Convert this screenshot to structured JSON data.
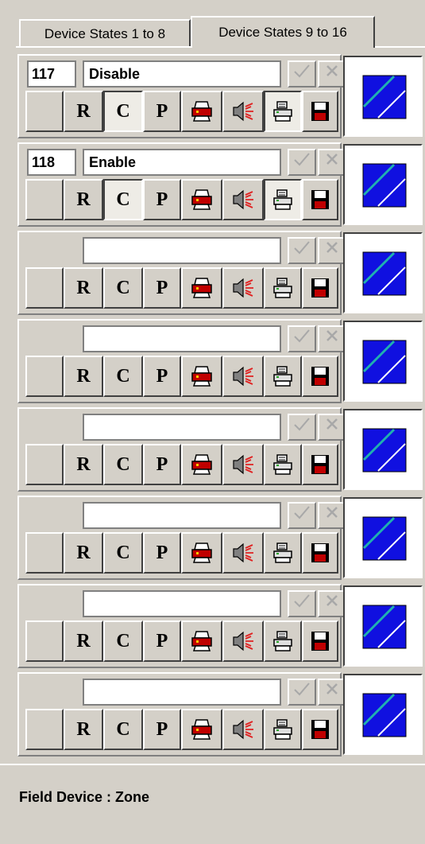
{
  "tabs": [
    {
      "label": "Device States 1 to 8",
      "active": false
    },
    {
      "label": "Device States 9 to 16",
      "active": true
    }
  ],
  "rows": [
    {
      "number": "117",
      "name": "Disable",
      "pressed": [
        "c",
        "doc"
      ]
    },
    {
      "number": "118",
      "name": "Enable",
      "pressed": [
        "c",
        "doc"
      ]
    },
    {
      "number": "",
      "name": "",
      "pressed": []
    },
    {
      "number": "",
      "name": "",
      "pressed": []
    },
    {
      "number": "",
      "name": "",
      "pressed": []
    },
    {
      "number": "",
      "name": "",
      "pressed": []
    },
    {
      "number": "",
      "name": "",
      "pressed": []
    },
    {
      "number": "",
      "name": "",
      "pressed": []
    }
  ],
  "button_labels": {
    "r": "R",
    "c": "C",
    "p": "P"
  },
  "icons": {
    "ok": "checkmark-icon",
    "x": "close-icon",
    "printer": "printer-icon",
    "speaker": "sounder-icon",
    "doc": "print-log-icon",
    "save": "save-icon",
    "state": "device-state-icon"
  },
  "colors": {
    "state_fill": "#1010e0",
    "state_line": "#20b0b0"
  },
  "footer": {
    "label": "Field Device :   Zone"
  }
}
